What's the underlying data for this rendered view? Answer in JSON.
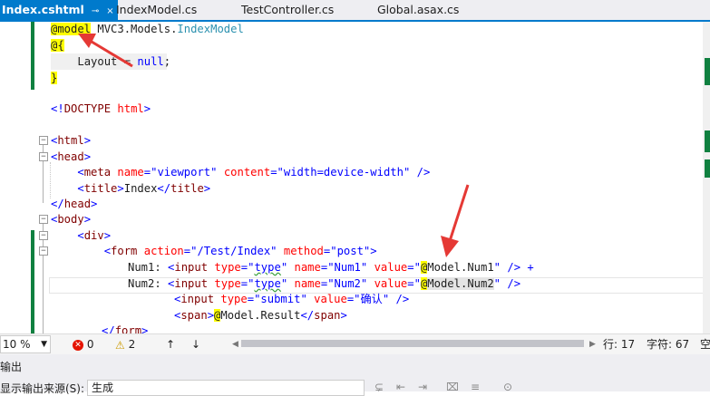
{
  "tabs": [
    {
      "label": "Index.cshtml",
      "active": true,
      "icon": "pin-icon",
      "close": "×"
    },
    {
      "label": "IndexModel.cs",
      "active": false
    },
    {
      "label": "TestController.cs",
      "active": false
    },
    {
      "label": "Global.asax.cs",
      "active": false
    }
  ],
  "code": {
    "l1": {
      "directive": "@model",
      "rest": " MVC3.Models.",
      "type": "IndexModel"
    },
    "l2": "@{",
    "l3": {
      "a": "Layout = ",
      "b": "null",
      "c": ";"
    },
    "l4": "}",
    "l6": {
      "a": "<!",
      "b": "DOCTYPE",
      "c": " html",
      "d": ">"
    },
    "l8": "html",
    "l9": "head",
    "l10": {
      "el": "meta",
      "a1": "name",
      "v1": "\"viewport\"",
      "a2": "content",
      "v2": "\"width=device-width\"",
      "end": " />"
    },
    "l11": {
      "el": "title",
      "text": "Index"
    },
    "l12": "head",
    "l13": "body",
    "l14": "div",
    "l15": {
      "el": "form",
      "a1": "action",
      "v1": "\"/Test/Index\"",
      "a2": "method",
      "v2": "\"post\""
    },
    "l16": {
      "label": "Num1: ",
      "el": "input",
      "a1": "type",
      "v1a": "\"",
      "v1b": "type",
      "v1c": "\"",
      "a2": "name",
      "v2": "\"Num1\"",
      "a3": "value",
      "v3a": "\"",
      "at": "@",
      "expr": "Model.Num1",
      "v3c": "\"",
      "end": " /> +"
    },
    "l17": {
      "label": "Num2: ",
      "el": "input",
      "a1": "type",
      "v1a": "\"",
      "v1b": "type",
      "v1c": "\"",
      "a2": "name",
      "v2": "\"Num2\"",
      "a3": "value",
      "v3a": "\"",
      "at": "@",
      "expr": "Model.Num2",
      "v3c": "\"",
      "end": " />"
    },
    "l18": {
      "el": "input",
      "a1": "type",
      "v1": "\"submit\"",
      "a2": "value",
      "v2": "\"确认\"",
      "end": " />"
    },
    "l19": {
      "el": "span",
      "at": "@",
      "expr": "Model.Result"
    },
    "l20": "form"
  },
  "statusbar": {
    "zoom": "10 %",
    "errors": "0",
    "warnings": "2",
    "up": "↑",
    "down": "↓",
    "line": "行: 17",
    "col": "字符: 67",
    "extra": "空"
  },
  "output": {
    "title": "输出",
    "source_label": "显示输出来源(S):",
    "source_value": "生成"
  },
  "colors": {
    "accent": "#007acc",
    "change_bar": "#108040",
    "highlight": "#ffff00",
    "arrow": "#e53935"
  }
}
